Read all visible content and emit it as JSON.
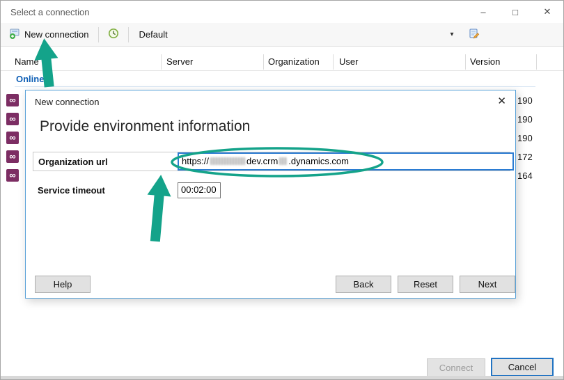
{
  "window": {
    "title": "Select a connection",
    "minimize": "–",
    "maximize": "□",
    "close": "✕"
  },
  "toolbar": {
    "new_connection_label": "New connection",
    "profile_value": "Default",
    "dropdown_arrow": "▾"
  },
  "table": {
    "columns": [
      "Name",
      "Server",
      "Organization",
      "User",
      "Version"
    ],
    "group_label": "Online",
    "icon_glyph": "∞",
    "rows": [
      {
        "version": "190"
      },
      {
        "version": "190"
      },
      {
        "version": "190"
      },
      {
        "version": "172"
      },
      {
        "version": "164"
      }
    ]
  },
  "dialog": {
    "title": "New connection",
    "close": "✕",
    "heading": "Provide environment information",
    "org_url_label": "Organization url",
    "url_prefix": "https://",
    "url_mid": "dev.crm",
    "url_suffix": ".dynamics.com",
    "timeout_label": "Service timeout",
    "timeout_value": "00:02:00",
    "help_label": "Help",
    "back_label": "Back",
    "reset_label": "Reset",
    "next_label": "Next"
  },
  "footer": {
    "connect_label": "Connect",
    "cancel_label": "Cancel"
  },
  "annotations": {
    "color": "#14a38a"
  }
}
